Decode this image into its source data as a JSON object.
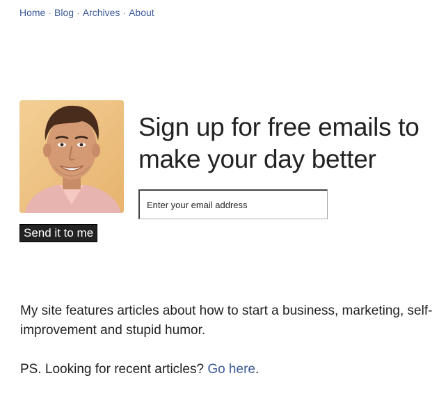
{
  "nav": {
    "items": [
      {
        "label": "Home"
      },
      {
        "label": "Blog"
      },
      {
        "label": "Archives"
      },
      {
        "label": "About"
      }
    ],
    "separator": "·"
  },
  "signup": {
    "headline": "Sign up for free emails to make your day better",
    "email_placeholder": "Enter your email address",
    "submit_label": "Send it to me"
  },
  "intro": {
    "description": "My site features articles about how to start a business, marketing, self-improvement and stupid humor.",
    "ps_prefix": "PS. Looking for recent articles? ",
    "ps_link": "Go here",
    "ps_suffix": "."
  },
  "colors": {
    "link": "#3b5998",
    "text": "#222222",
    "button_bg": "#222222"
  },
  "icons": {
    "photo": "author-portrait"
  }
}
